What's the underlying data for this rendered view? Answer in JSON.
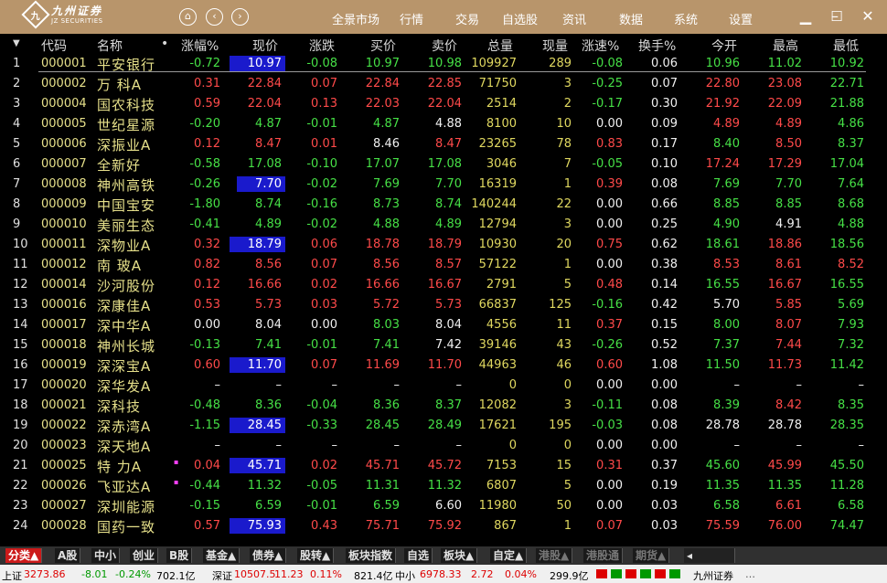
{
  "app": {
    "logo_cn": "九州证券",
    "logo_en": "JZ SECURITIES",
    "logo_mark": "九"
  },
  "menu": [
    "全景市场",
    "行情",
    "交易",
    "自选股",
    "资讯",
    "数据",
    "系统",
    "设置"
  ],
  "nav_icons": [
    "home-icon",
    "back-icon",
    "forward-icon"
  ],
  "window_controls": [
    "minimize-icon",
    "restore-icon",
    "maximize-icon",
    "close-icon"
  ],
  "columns": [
    "代码",
    "名称",
    "•",
    "涨幅%",
    "现价",
    "涨跌",
    "买价",
    "卖价",
    "总量",
    "现量",
    "涨速%",
    "换手%",
    "今开",
    "最高",
    "最低"
  ],
  "rows": [
    [
      "1",
      "000001",
      "平安银行",
      "",
      "-0.72",
      "10.97",
      "-0.08",
      "10.97",
      "10.98",
      "109927",
      "289",
      "-0.08",
      "0.06",
      "10.96",
      "11.02",
      "10.92"
    ],
    [
      "2",
      "000002",
      "万 科A",
      "",
      "0.31",
      "22.84",
      "0.07",
      "22.84",
      "22.85",
      "71750",
      "3",
      "-0.25",
      "0.07",
      "22.80",
      "23.08",
      "22.71"
    ],
    [
      "3",
      "000004",
      "国农科技",
      "",
      "0.59",
      "22.04",
      "0.13",
      "22.03",
      "22.04",
      "2514",
      "2",
      "-0.17",
      "0.30",
      "21.92",
      "22.09",
      "21.88"
    ],
    [
      "4",
      "000005",
      "世纪星源",
      "",
      "-0.20",
      "4.87",
      "-0.01",
      "4.87",
      "4.88",
      "8100",
      "10",
      "0.00",
      "0.09",
      "4.89",
      "4.89",
      "4.86"
    ],
    [
      "5",
      "000006",
      "深振业A",
      "",
      "0.12",
      "8.47",
      "0.01",
      "8.46",
      "8.47",
      "23265",
      "78",
      "0.83",
      "0.17",
      "8.40",
      "8.50",
      "8.37"
    ],
    [
      "6",
      "000007",
      "全新好",
      "",
      "-0.58",
      "17.08",
      "-0.10",
      "17.07",
      "17.08",
      "3046",
      "7",
      "-0.05",
      "0.10",
      "17.24",
      "17.29",
      "17.04"
    ],
    [
      "7",
      "000008",
      "神州高铁",
      "",
      "-0.26",
      "7.70",
      "-0.02",
      "7.69",
      "7.70",
      "16319",
      "1",
      "0.39",
      "0.08",
      "7.69",
      "7.70",
      "7.64"
    ],
    [
      "8",
      "000009",
      "中国宝安",
      "",
      "-1.80",
      "8.74",
      "-0.16",
      "8.73",
      "8.74",
      "140244",
      "22",
      "0.00",
      "0.66",
      "8.85",
      "8.85",
      "8.68"
    ],
    [
      "9",
      "000010",
      "美丽生态",
      "",
      "-0.41",
      "4.89",
      "-0.02",
      "4.88",
      "4.89",
      "12794",
      "3",
      "0.00",
      "0.25",
      "4.90",
      "4.91",
      "4.88"
    ],
    [
      "10",
      "000011",
      "深物业A",
      "",
      "0.32",
      "18.79",
      "0.06",
      "18.78",
      "18.79",
      "10930",
      "20",
      "0.75",
      "0.62",
      "18.61",
      "18.86",
      "18.56"
    ],
    [
      "11",
      "000012",
      "南 玻A",
      "",
      "0.82",
      "8.56",
      "0.07",
      "8.56",
      "8.57",
      "57122",
      "1",
      "0.00",
      "0.38",
      "8.53",
      "8.61",
      "8.52"
    ],
    [
      "12",
      "000014",
      "沙河股份",
      "",
      "0.12",
      "16.66",
      "0.02",
      "16.66",
      "16.67",
      "2791",
      "5",
      "0.48",
      "0.14",
      "16.55",
      "16.67",
      "16.55"
    ],
    [
      "13",
      "000016",
      "深康佳A",
      "",
      "0.53",
      "5.73",
      "0.03",
      "5.72",
      "5.73",
      "66837",
      "125",
      "-0.16",
      "0.42",
      "5.70",
      "5.85",
      "5.69"
    ],
    [
      "14",
      "000017",
      "深中华A",
      "",
      "0.00",
      "8.04",
      "0.00",
      "8.03",
      "8.04",
      "4556",
      "11",
      "0.37",
      "0.15",
      "8.00",
      "8.07",
      "7.93"
    ],
    [
      "15",
      "000018",
      "神州长城",
      "",
      "-0.13",
      "7.41",
      "-0.01",
      "7.41",
      "7.42",
      "39146",
      "43",
      "-0.26",
      "0.52",
      "7.37",
      "7.44",
      "7.32"
    ],
    [
      "16",
      "000019",
      "深深宝A",
      "",
      "0.60",
      "11.70",
      "0.07",
      "11.69",
      "11.70",
      "44963",
      "46",
      "0.60",
      "1.08",
      "11.50",
      "11.73",
      "11.42"
    ],
    [
      "17",
      "000020",
      "深华发A",
      "",
      "–",
      "–",
      "–",
      "–",
      "–",
      "0",
      "0",
      "0.00",
      "0.00",
      "–",
      "–",
      "–"
    ],
    [
      "18",
      "000021",
      "深科技",
      "",
      "-0.48",
      "8.36",
      "-0.04",
      "8.36",
      "8.37",
      "12082",
      "3",
      "-0.11",
      "0.08",
      "8.39",
      "8.42",
      "8.35"
    ],
    [
      "19",
      "000022",
      "深赤湾A",
      "",
      "-1.15",
      "28.45",
      "-0.33",
      "28.45",
      "28.49",
      "17621",
      "195",
      "-0.03",
      "0.08",
      "28.78",
      "28.78",
      "28.35"
    ],
    [
      "20",
      "000023",
      "深天地A",
      "",
      "–",
      "–",
      "–",
      "–",
      "–",
      "0",
      "0",
      "0.00",
      "0.00",
      "–",
      "–",
      "–"
    ],
    [
      "21",
      "000025",
      "特 力A",
      "▪",
      "0.04",
      "45.71",
      "0.02",
      "45.71",
      "45.72",
      "7153",
      "15",
      "0.31",
      "0.37",
      "45.60",
      "45.99",
      "45.50"
    ],
    [
      "22",
      "000026",
      "飞亚达A",
      "▪",
      "-0.44",
      "11.32",
      "-0.05",
      "11.31",
      "11.32",
      "6807",
      "5",
      "0.00",
      "0.19",
      "11.35",
      "11.35",
      "11.28"
    ],
    [
      "23",
      "000027",
      "深圳能源",
      "",
      "-0.15",
      "6.59",
      "-0.01",
      "6.59",
      "6.60",
      "11980",
      "50",
      "0.00",
      "0.03",
      "6.58",
      "6.61",
      "6.58"
    ],
    [
      "24",
      "000028",
      "国药一致",
      "",
      "0.57",
      "75.93",
      "0.43",
      "75.71",
      "75.92",
      "867",
      "1",
      "0.07",
      "0.03",
      "75.59",
      "76.00",
      "74.47"
    ]
  ],
  "tabs": [
    "分类▲",
    "A股",
    "中小",
    "创业",
    "B股",
    "基金▲",
    "债券▲",
    "股转▲",
    "板块指数",
    "自选",
    "板块▲",
    "自定▲",
    "港股▲",
    "港股通",
    "期货▲"
  ],
  "status": {
    "sh_label": "上证",
    "sh_val": "3273.86",
    "sh_chg": "-8.01",
    "sh_pct": "-0.24%",
    "sh_amt": "702.1亿",
    "sz_label": "深证",
    "sz_val": "10507.5",
    "sz_chg": "11.23",
    "sz_pct": "0.11%",
    "sz_amt": "821.4亿",
    "zx_label": "中小",
    "zx_val": "6978.33",
    "zx_chg": "2.72",
    "zx_pct": "0.04%",
    "zx_amt": "299.9亿",
    "broker": "九州证券"
  }
}
